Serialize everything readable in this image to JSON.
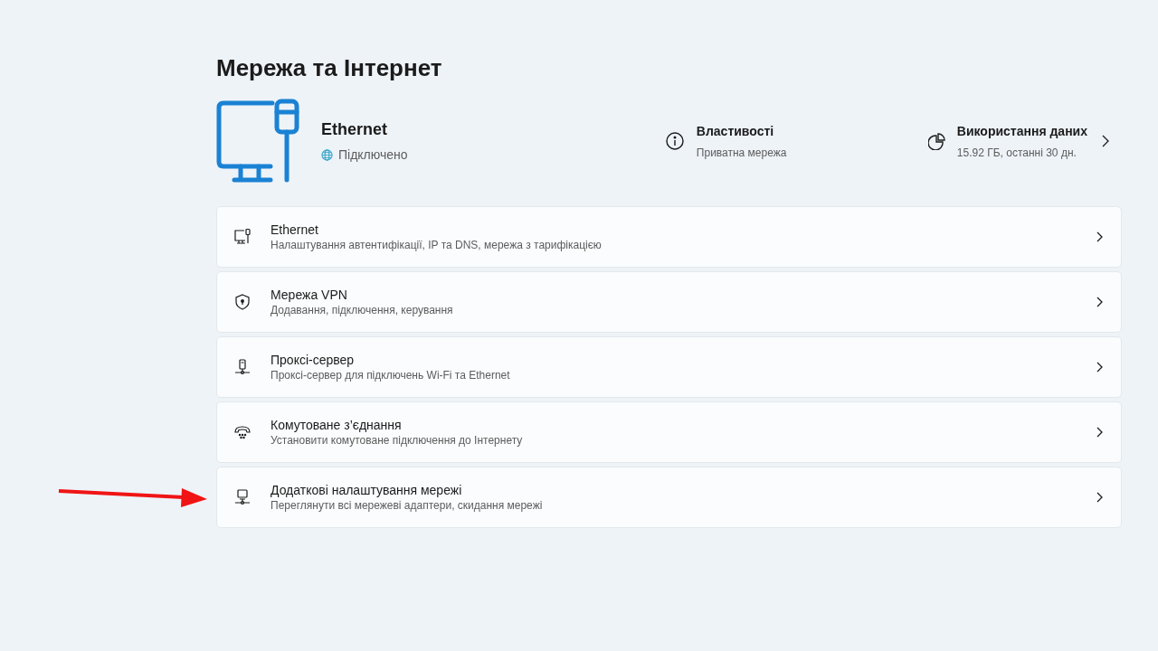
{
  "page_title": "Мережа та Інтернет",
  "connection": {
    "name": "Ethernet",
    "status": "Підключено"
  },
  "properties": {
    "title": "Властивості",
    "subtitle": "Приватна мережа"
  },
  "data_usage": {
    "title": "Використання даних",
    "subtitle": "15.92 ГБ, останні 30 дн."
  },
  "items": [
    {
      "title": "Ethernet",
      "subtitle": "Налаштування автентифікації, IP та DNS, мережа з тарифікацією"
    },
    {
      "title": "Мережа VPN",
      "subtitle": "Додавання, підключення, керування"
    },
    {
      "title": "Проксі-сервер",
      "subtitle": "Проксі-сервер для підключень Wi-Fi та Ethernet"
    },
    {
      "title": "Комутоване з’єднання",
      "subtitle": "Установити комутоване підключення до Інтернету"
    },
    {
      "title": "Додаткові налаштування мережі",
      "subtitle": "Переглянути всі мережеві адаптери, скидання мережі"
    }
  ]
}
